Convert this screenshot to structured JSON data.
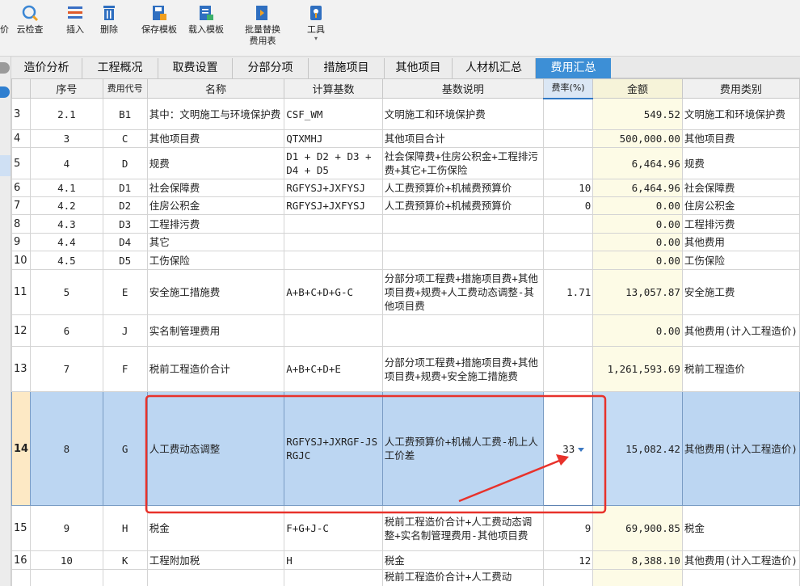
{
  "toolbar": {
    "items": [
      {
        "label": "价",
        "icon": "price-icon"
      },
      {
        "label": "云检查",
        "icon": "cloud-check-icon"
      },
      {
        "label": "插入",
        "icon": "insert-icon"
      },
      {
        "label": "删除",
        "icon": "delete-icon"
      },
      {
        "label": "保存模板",
        "icon": "save-template-icon"
      },
      {
        "label": "载入模板",
        "icon": "load-template-icon"
      },
      {
        "label": "批量替换",
        "label2": "费用表",
        "icon": "batch-replace-icon"
      },
      {
        "label": "工具",
        "icon": "tools-icon"
      }
    ]
  },
  "tabs": [
    "造价分析",
    "工程概况",
    "取费设置",
    "分部分项",
    "措施项目",
    "其他项目",
    "人材机汇总",
    "费用汇总"
  ],
  "active_tab": "费用汇总",
  "columns": [
    "序号",
    "费用代号",
    "名称",
    "计算基数",
    "基数说明",
    "费率(%)",
    "金额",
    "费用类别"
  ],
  "rows": [
    {
      "rn": "3",
      "seq": "2.1",
      "code": "B1",
      "name": "其中：文明施工与环境保护费",
      "base": "CSF_WM",
      "desc": "文明施工和环境保护费",
      "rate": "",
      "amount": "549.52",
      "category": "文明施工和环境保护费"
    },
    {
      "rn": "4",
      "seq": "3",
      "code": "C",
      "name": "其他项目费",
      "base": "QTXMHJ",
      "desc": "其他项目合计",
      "rate": "",
      "amount": "500,000.00",
      "category": "其他项目费"
    },
    {
      "rn": "5",
      "seq": "4",
      "code": "D",
      "name": "规费",
      "base": "D1 + D2 + D3 + D4 + D5",
      "desc": "社会保障费+住房公积金+工程排污费+其它+工伤保险",
      "rate": "",
      "amount": "6,464.96",
      "category": "规费"
    },
    {
      "rn": "6",
      "seq": "4.1",
      "code": "D1",
      "name": "社会保障费",
      "base": "RGFYSJ+JXFYSJ",
      "desc": "人工费预算价+机械费预算价",
      "rate": "10",
      "amount": "6,464.96",
      "category": "社会保障费"
    },
    {
      "rn": "7",
      "seq": "4.2",
      "code": "D2",
      "name": "住房公积金",
      "base": "RGFYSJ+JXFYSJ",
      "desc": "人工费预算价+机械费预算价",
      "rate": "0",
      "amount": "0.00",
      "category": "住房公积金"
    },
    {
      "rn": "8",
      "seq": "4.3",
      "code": "D3",
      "name": "工程排污费",
      "base": "",
      "desc": "",
      "rate": "",
      "amount": "0.00",
      "category": "工程排污费"
    },
    {
      "rn": "9",
      "seq": "4.4",
      "code": "D4",
      "name": "其它",
      "base": "",
      "desc": "",
      "rate": "",
      "amount": "0.00",
      "category": "其他费用"
    },
    {
      "rn": "10",
      "seq": "4.5",
      "code": "D5",
      "name": "工伤保险",
      "base": "",
      "desc": "",
      "rate": "",
      "amount": "0.00",
      "category": "工伤保险"
    },
    {
      "rn": "11",
      "seq": "5",
      "code": "E",
      "name": "安全施工措施费",
      "base": "A+B+C+D+G-C",
      "desc": "分部分项工程费+措施项目费+其他项目费+规费+人工费动态调整-其他项目费",
      "rate": "1.71",
      "amount": "13,057.87",
      "category": "安全施工费"
    },
    {
      "rn": "12",
      "seq": "6",
      "code": "J",
      "name": "实名制管理费用",
      "base": "",
      "desc": "",
      "rate": "",
      "amount": "0.00",
      "category": "其他费用(计入工程造价)"
    },
    {
      "rn": "13",
      "seq": "7",
      "code": "F",
      "name": "税前工程造价合计",
      "base": "A+B+C+D+E",
      "desc": "分部分项工程费+措施项目费+其他项目费+规费+安全施工措施费",
      "rate": "",
      "amount": "1,261,593.69",
      "category": "税前工程造价"
    },
    {
      "rn": "14",
      "seq": "8",
      "code": "G",
      "name": "人工费动态调整",
      "base": "RGFYSJ+JXRGF-JSRGJC",
      "desc": "人工费预算价+机械人工费-机上人工价差",
      "rate": "33",
      "amount": "15,082.42",
      "category": "其他费用(计入工程造价)",
      "selected": true
    },
    {
      "rn": "15",
      "seq": "9",
      "code": "H",
      "name": "税金",
      "base": "F+G+J-C",
      "desc": "税前工程造价合计+人工费动态调整+实名制管理费用-其他项目费",
      "rate": "9",
      "amount": "69,900.85",
      "category": "税金"
    },
    {
      "rn": "16",
      "seq": "10",
      "code": "K",
      "name": "工程附加税",
      "base": "H",
      "desc": "税金",
      "rate": "12",
      "amount": "8,388.10",
      "category": "其他费用(计入工程造价)"
    },
    {
      "rn": "",
      "seq": "",
      "code": "",
      "name": "",
      "base": "",
      "desc": "税前工程造价合计+人工费动",
      "rate": "",
      "amount": "",
      "category": ""
    }
  ],
  "colors": {
    "tab_active": "#3d8fd6",
    "selected_row": "#bcd6f2",
    "amount_bg": "#fdfbe6",
    "highlight": "#e8322b"
  }
}
